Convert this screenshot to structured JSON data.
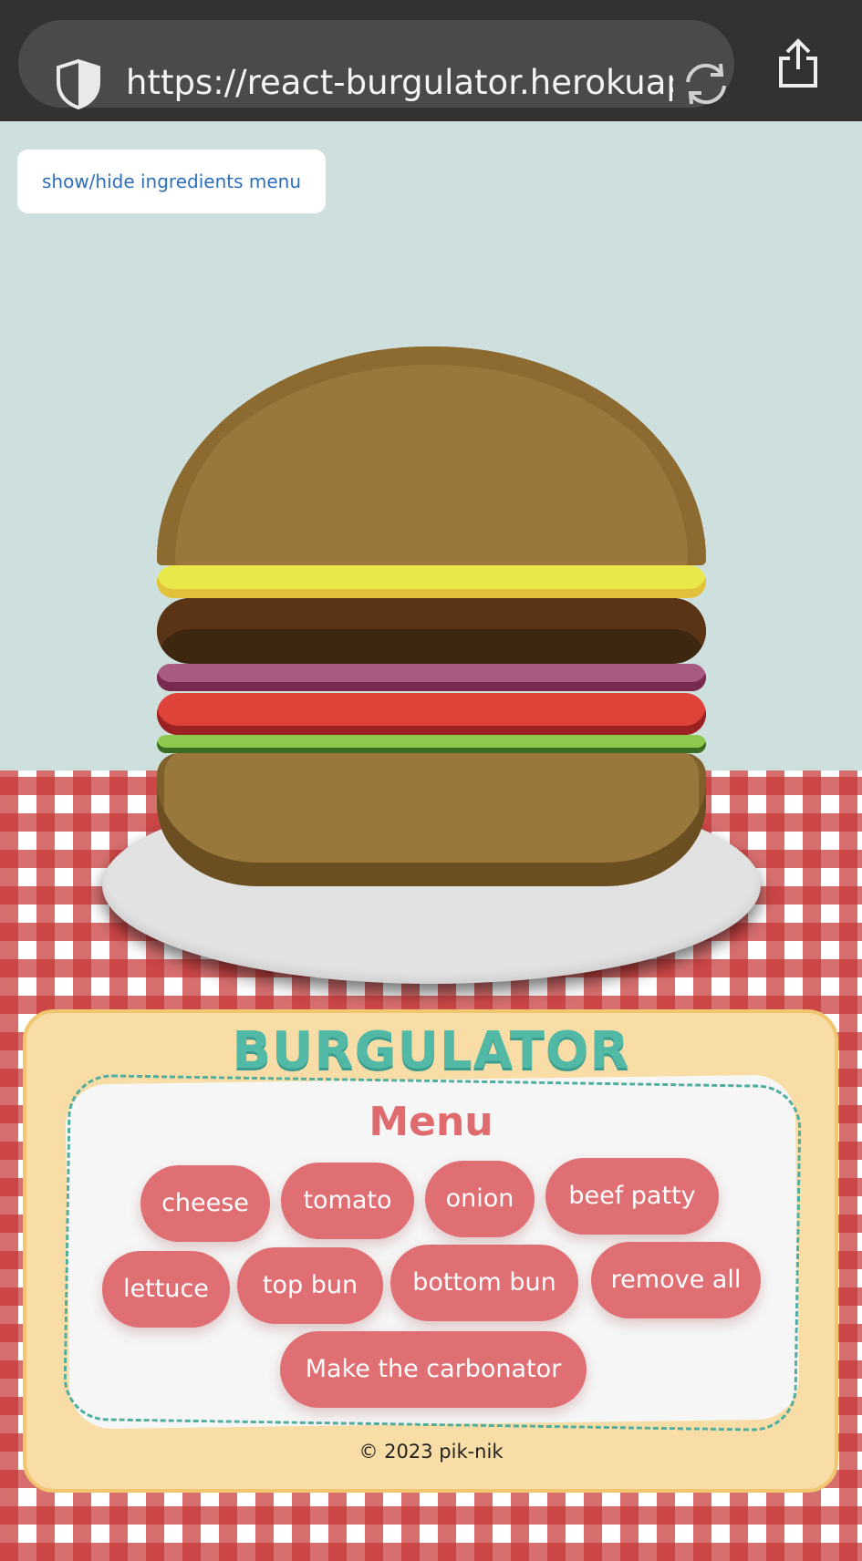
{
  "browser": {
    "url": "https://react-burgulator.herokuap...",
    "icons": [
      "shield-icon",
      "reload-icon",
      "share-icon"
    ]
  },
  "page": {
    "toggle_button": "show/hide ingredients menu"
  },
  "burger_layers": [
    "top bun",
    "cheese",
    "beef patty",
    "onion",
    "tomato",
    "lettuce",
    "bottom bun"
  ],
  "panel": {
    "brand": "BURGULATOR",
    "menu_title": "Menu",
    "buttons": {
      "cheese": "cheese",
      "tomato": "tomato",
      "onion": "onion",
      "beef_patty": "beef patty",
      "lettuce": "lettuce",
      "top_bun": "top bun",
      "bottom_bun": "bottom bun",
      "remove_all": "remove all",
      "carbonator": "Make the carbonator"
    },
    "footer": "© 2023 pik-nik"
  },
  "colors": {
    "background": "#cde0de",
    "accent_red": "#e06f74",
    "brand_teal": "#52b9a7",
    "panel": "#f8dea6"
  }
}
